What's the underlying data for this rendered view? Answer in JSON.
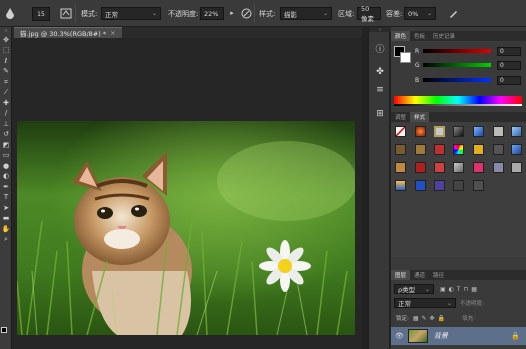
{
  "options_bar": {
    "brush_size": "15",
    "mode_label": "模式:",
    "mode_value": "正常",
    "opacity_label": "不透明度:",
    "opacity_value": "22%",
    "style_label": "样式:",
    "style_value": "描影",
    "area_label": "区域:",
    "area_value": "50 像素",
    "tolerance_label": "容差:",
    "tolerance_value": "0%"
  },
  "document": {
    "tab_title": "猫.jpg @ 30.3%(RGB/8#) *",
    "close": "×"
  },
  "color_panel": {
    "tabs": [
      "颜色",
      "色板",
      "历史记录"
    ],
    "channels": [
      {
        "label": "R",
        "value": "0",
        "color": "#d02020"
      },
      {
        "label": "G",
        "value": "0",
        "color": "#20b020"
      },
      {
        "label": "B",
        "value": "0",
        "color": "#2040d0"
      }
    ]
  },
  "styles_panel": {
    "tabs": [
      "调整",
      "样式"
    ]
  },
  "layers_panel": {
    "tabs": [
      "图层",
      "通道",
      "路径"
    ],
    "kind_label": "ρ类型",
    "blend_mode": "正常",
    "opacity_label": "不透明度:",
    "lock_label": "锁定:",
    "fill_label": "填充:",
    "layer_name": "背景"
  },
  "icons": {
    "tool_icons": [
      "move-icon",
      "marquee-icon",
      "lasso-icon",
      "quick-select-icon",
      "crop-icon",
      "eyedropper-icon",
      "healing-icon",
      "brush-icon",
      "stamp-icon",
      "history-brush-icon",
      "eraser-icon",
      "gradient-icon",
      "blur-icon",
      "dodge-icon",
      "pen-icon",
      "type-icon",
      "path-select-icon",
      "shape-icon",
      "hand-icon",
      "zoom-icon"
    ]
  },
  "colors": {
    "accent": "#3a6ea8",
    "layer_selected": "#5d6f8a",
    "foreground": "#000000",
    "background": "#ffffff"
  }
}
